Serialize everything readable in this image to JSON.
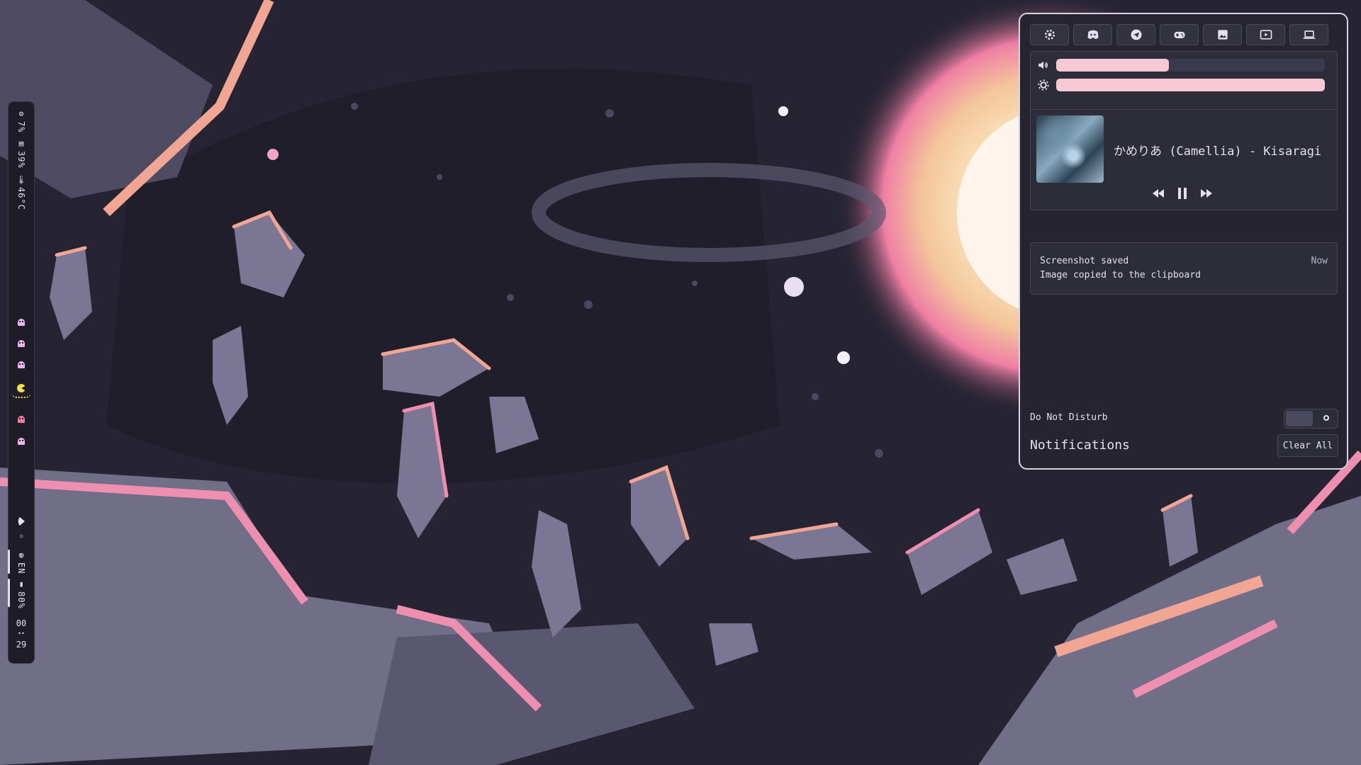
{
  "bar": {
    "cpu": "7%",
    "memory": "39%",
    "temperature": "46°C",
    "network_icon": "wifi-icon",
    "bluetooth_icon": "bluetooth-icon",
    "language": "EN",
    "battery": "80%",
    "clock_hour": "00",
    "clock_sep": "••",
    "clock_minute": "29",
    "workspaces": [
      {
        "icon": "ghost-icon",
        "color": "#e6b7e8"
      },
      {
        "icon": "ghost-icon",
        "color": "#e6b7e8"
      },
      {
        "icon": "ghost-icon",
        "color": "#e6b7e8"
      },
      {
        "icon": "pacman-icon",
        "color": "#f2e34d",
        "active": true
      },
      {
        "icon": "ghost-icon",
        "color": "#f07aa2"
      },
      {
        "icon": "ghost-icon",
        "color": "#e6b7e8"
      }
    ]
  },
  "panel": {
    "quick_buttons": [
      "settings-icon",
      "discord-icon",
      "telegram-icon",
      "gamepad-icon",
      "image-icon",
      "video-icon",
      "laptop-icon"
    ],
    "volume_level": 0.42,
    "brightness_level": 1.0,
    "media": {
      "title": "かめりあ (Camellia) - Kisaragi",
      "buttons": [
        "previous-icon",
        "pause-icon",
        "next-icon"
      ]
    },
    "notification": {
      "title": "Screenshot saved",
      "body": "Image copied to the clipboard",
      "time": "Now"
    },
    "dnd_label": "Do Not Disturb",
    "heading": "Notifications",
    "clear_all": "Clear All"
  },
  "colors": {
    "accent": "#f6c9d4",
    "panel_bg": "#25242f",
    "card_bg": "#2d2c39"
  }
}
